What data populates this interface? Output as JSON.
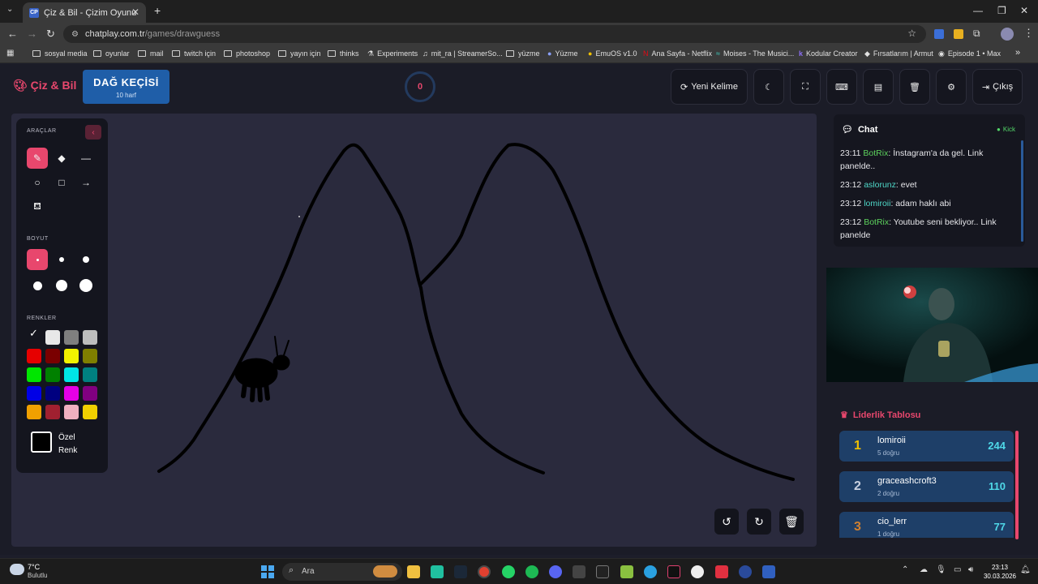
{
  "browser": {
    "tab_title": "Çiz & Bil - Çizim Oyunu",
    "tab_favicon": "CP",
    "url_host": "chatplay.com.tr",
    "url_path": "/games/drawguess",
    "bookmarks": [
      "sosyal media",
      "oyunlar",
      "mail",
      "twitch için",
      "photoshop",
      "yayın için",
      "thinks",
      "Experiments",
      "mit_ra | StreamerSo...",
      "yüzme",
      "Yüzme",
      "EmuOS v1.0",
      "Ana Sayfa - Netflix",
      "Moises - The Musici...",
      "Kodular Creator",
      "Fırsatlarım | Armut",
      "Episode 1 • Max"
    ]
  },
  "header": {
    "logo": "Çiz & Bil",
    "word": "DAĞ KEÇİSİ",
    "word_length": "10 harf",
    "timer": "0",
    "new_word_label": "Yeni Kelime",
    "exit_label": "Çıkış"
  },
  "tools": {
    "section_tools": "ARAÇLAR",
    "section_size": "BOYUT",
    "section_colors": "RENKLER",
    "custom_color_line1": "Özel",
    "custom_color_line2": "Renk",
    "colors": [
      "#ffffff",
      "#e8e8e8",
      "#7f7f7f",
      "#bdbdbd",
      "#e60000",
      "#7a0000",
      "#f2f200",
      "#7f7f00",
      "#00e600",
      "#008000",
      "#00e6e6",
      "#008080",
      "#0000e6",
      "#000080",
      "#e600e6",
      "#800080",
      "#f0a000",
      "#a02030",
      "#f0b0c0",
      "#f0d000"
    ]
  },
  "chat": {
    "title": "Chat",
    "platform": "Kick",
    "messages": [
      {
        "time": "23:11",
        "user": "BotRix",
        "text": ": İnstagram'a da gel. Link panelde.."
      },
      {
        "time": "23:12",
        "user": "aslorunz",
        "text": ": evet"
      },
      {
        "time": "23:12",
        "user": "lomiroii",
        "text": ": adam haklı abi"
      },
      {
        "time": "23:12",
        "user": "BotRix",
        "text": ": Youtube seni bekliyor.. Link panelde"
      }
    ]
  },
  "leaderboard": {
    "title": "Liderlik Tablosu",
    "rows": [
      {
        "rank": "1",
        "name": "lomiroii",
        "correct": "5 doğru",
        "score": "244"
      },
      {
        "rank": "2",
        "name": "graceashcroft3",
        "correct": "2 doğru",
        "score": "110"
      },
      {
        "rank": "3",
        "name": "cio_lerr",
        "correct": "1 doğru",
        "score": "77"
      }
    ]
  },
  "taskbar": {
    "weather_temp": "7°C",
    "weather_desc": "Bulutlu",
    "search_placeholder": "Ara",
    "time": "23:13",
    "date": "30.03.2026"
  }
}
